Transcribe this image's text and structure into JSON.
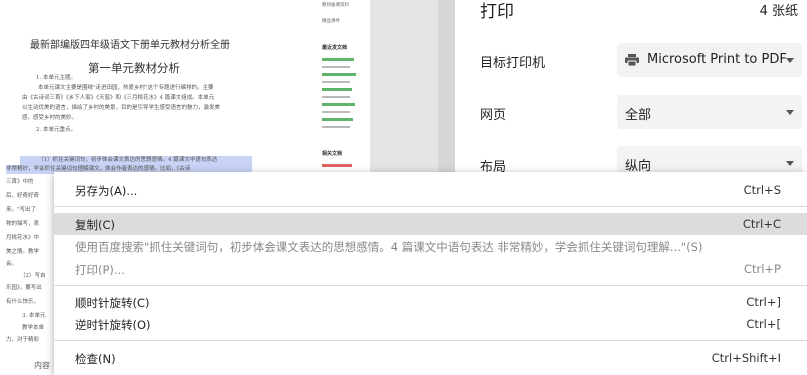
{
  "document": {
    "title": "最新部编版四年级语文下册单元教材分析全册",
    "subtitle": "第一单元教材分析",
    "lines": [
      "1. 本单元主题。",
      "本单元课文主要是围绕\"走进田园，热爱乡村\"这个专题进行编排的。主要",
      "由《古诗词三首》《乡下人家》《天窗》和《三月桃花水》4 篇课文组成。本单元",
      "以生动优美的语言，描绘了乡村的美景，目的是引导学生感受语言的魅力，激发美",
      "感，感受乡村的美妙。",
      "2. 本单元重点。",
      "（1）抓住关键词句，初步体会课文表达的思想感情。4 篇课文中语句表达",
      "非常精妙，学会抓住关键词句理解课文，体会作者表达的感情。比如，《古诗",
      "三首》中的",
      "后，好奇好奇",
      "来。\"写出了",
      "物的描写，表",
      "月桃花水》中",
      "美之情。教学",
      "会。",
      "（2）写自",
      "乐园》，要写出",
      "有什么快乐，",
      "3. 本单元",
      "教学本单",
      "力，对于精彩"
    ],
    "footer": "内容",
    "side": {
      "head1": "教师备课资料",
      "head1b": "精品课件",
      "head2": "最近发文档",
      "head3": "相关文档"
    }
  },
  "print": {
    "title": "打印",
    "sheets": "4 张纸",
    "printer_label": "目标打印机",
    "printer_value": "Microsoft Print to PDF",
    "printer_icon": "printer-icon",
    "pages_label": "网页",
    "pages_value": "全部",
    "layout_label": "布局",
    "layout_value": "纵向"
  },
  "menu": {
    "items": [
      {
        "label": "另存为(A)...",
        "shortcut": "Ctrl+S"
      },
      {
        "label": "复制(C)",
        "shortcut": "Ctrl+C"
      },
      {
        "label": "使用百度搜索\"抓住关键词句，初步体会课文表达的思想感情。4 篇课文中语句表达  非常精妙，学会抓住关键词句理解...\"(S)",
        "shortcut": ""
      },
      {
        "label": "打印(P)...",
        "shortcut": "Ctrl+P"
      },
      {
        "label": "顺时针旋转(C)",
        "shortcut": "Ctrl+]"
      },
      {
        "label": "逆时针旋转(O)",
        "shortcut": "Ctrl+["
      },
      {
        "label": "检查(N)",
        "shortcut": "Ctrl+Shift+I"
      }
    ]
  },
  "colors": {
    "highlight": "#c9d3f5",
    "menu_hover": "#dcdcdc",
    "select_bg": "#f1f3f4"
  }
}
